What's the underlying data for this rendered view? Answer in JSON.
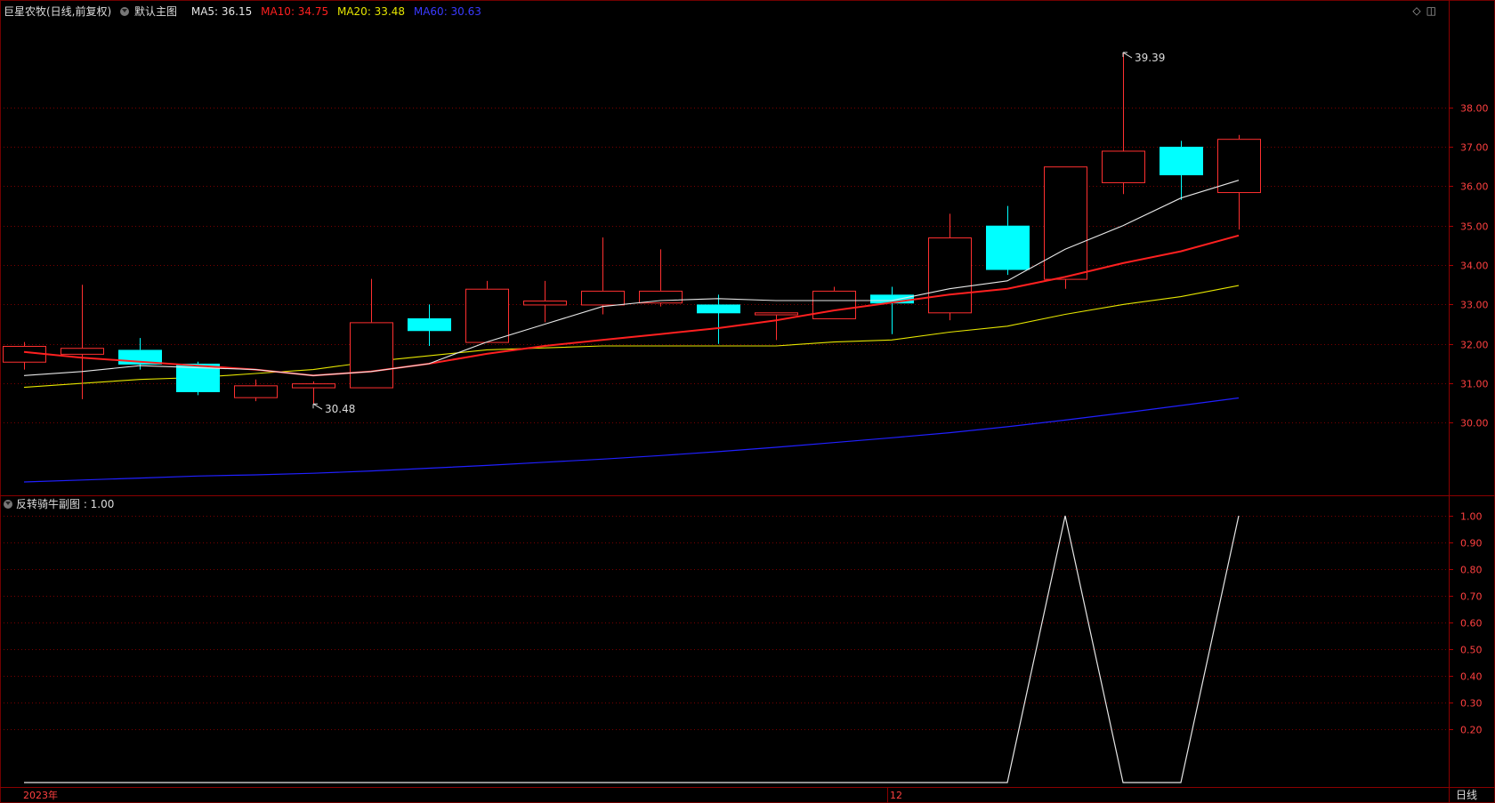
{
  "header": {
    "stock": "巨星农牧(日线,前复权)",
    "template": "默认主图",
    "ma5": "MA5: 36.15",
    "ma10": "MA10: 34.75",
    "ma20": "MA20: 33.48",
    "ma60": "MA60: 30.63"
  },
  "sub_header": "反转骑牛副图 : 1.00",
  "period_label": "日线",
  "icons": [
    "diamond-icon",
    "window-icon"
  ],
  "colors": {
    "ma5": "#e6e6e6",
    "ma10": "#ff2020",
    "ma20": "#e6e600",
    "ma60": "#2020ff",
    "up": "#ff3030",
    "down": "#00ffff",
    "grid": "#7a0000",
    "axis_text": "#ff4040"
  },
  "chart_data": [
    {
      "type": "candlestick",
      "title": "巨星农牧(日线,前复权)",
      "x_labels": [
        "2023年",
        "12"
      ],
      "ylim": [
        28.5,
        40.0
      ],
      "y_ticks": [
        30.0,
        31.0,
        32.0,
        33.0,
        34.0,
        35.0,
        36.0,
        37.0,
        38.0
      ],
      "candles": [
        {
          "open": 31.55,
          "high": 32.05,
          "low": 31.35,
          "close": 31.95
        },
        {
          "open": 31.75,
          "high": 33.5,
          "low": 30.6,
          "close": 31.9
        },
        {
          "open": 31.85,
          "high": 32.15,
          "low": 31.35,
          "close": 31.5
        },
        {
          "open": 31.5,
          "high": 31.55,
          "low": 30.7,
          "close": 30.8
        },
        {
          "open": 30.65,
          "high": 31.1,
          "low": 30.55,
          "close": 30.95
        },
        {
          "open": 30.9,
          "high": 31.05,
          "low": 30.48,
          "close": 31.0
        },
        {
          "open": 30.9,
          "high": 33.65,
          "low": 30.9,
          "close": 32.55
        },
        {
          "open": 32.65,
          "high": 33.0,
          "low": 31.95,
          "close": 32.35
        },
        {
          "open": 32.05,
          "high": 33.6,
          "low": 32.05,
          "close": 33.4
        },
        {
          "open": 33.0,
          "high": 33.6,
          "low": 32.55,
          "close": 33.1
        },
        {
          "open": 33.0,
          "high": 34.7,
          "low": 32.75,
          "close": 33.35
        },
        {
          "open": 33.05,
          "high": 34.4,
          "low": 32.95,
          "close": 33.35
        },
        {
          "open": 33.0,
          "high": 33.25,
          "low": 32.0,
          "close": 32.8
        },
        {
          "open": 32.75,
          "high": 32.8,
          "low": 32.1,
          "close": 32.8
        },
        {
          "open": 32.65,
          "high": 33.45,
          "low": 32.65,
          "close": 33.35
        },
        {
          "open": 33.25,
          "high": 33.45,
          "low": 32.25,
          "close": 33.05
        },
        {
          "open": 32.8,
          "high": 35.3,
          "low": 32.6,
          "close": 34.7
        },
        {
          "open": 35.0,
          "high": 35.5,
          "low": 33.75,
          "close": 33.9
        },
        {
          "open": 33.65,
          "high": 36.5,
          "low": 33.4,
          "close": 36.5
        },
        {
          "open": 36.1,
          "high": 39.39,
          "low": 35.8,
          "close": 36.9
        },
        {
          "open": 37.0,
          "high": 37.15,
          "low": 35.65,
          "close": 36.3
        },
        {
          "open": 35.85,
          "high": 37.3,
          "low": 34.9,
          "close": 37.2
        }
      ],
      "ma5": [
        31.2,
        31.3,
        31.45,
        31.4,
        31.35,
        31.2,
        31.3,
        31.5,
        32.05,
        32.5,
        32.95,
        33.1,
        33.15,
        33.1,
        33.1,
        33.1,
        33.4,
        33.6,
        34.4,
        35.0,
        35.7,
        36.15
      ],
      "ma10": [
        31.8,
        31.65,
        31.55,
        31.45,
        31.35,
        31.2,
        31.3,
        31.5,
        31.75,
        31.95,
        32.1,
        32.25,
        32.4,
        32.6,
        32.85,
        33.05,
        33.25,
        33.4,
        33.7,
        34.05,
        34.35,
        34.75
      ],
      "ma20": [
        30.9,
        31.0,
        31.1,
        31.15,
        31.25,
        31.35,
        31.55,
        31.7,
        31.85,
        31.9,
        31.95,
        31.95,
        31.95,
        31.95,
        32.05,
        32.1,
        32.3,
        32.45,
        32.75,
        33.0,
        33.2,
        33.48
      ],
      "ma60": [
        28.5,
        28.55,
        28.6,
        28.65,
        28.68,
        28.72,
        28.78,
        28.85,
        28.92,
        29.0,
        29.08,
        29.17,
        29.27,
        29.38,
        29.5,
        29.62,
        29.75,
        29.9,
        30.07,
        30.25,
        30.44,
        30.63
      ],
      "annotations": [
        {
          "label": "39.39",
          "candle": 19,
          "value": 39.39
        },
        {
          "label": "30.48",
          "candle": 5,
          "value": 30.48
        }
      ]
    },
    {
      "type": "line",
      "title": "反转骑牛副图",
      "ylim": [
        0.0,
        1.0
      ],
      "y_ticks": [
        0.2,
        0.3,
        0.4,
        0.5,
        0.6,
        0.7,
        0.8,
        0.9,
        1.0
      ],
      "y_tick_labels": [
        "0.20",
        "0.30",
        "0.40",
        "0.50",
        "0.60",
        "0.70",
        "0.80",
        "0.90",
        "1.00"
      ],
      "series": [
        {
          "values": [
            0,
            0,
            0,
            0,
            0,
            0,
            0,
            0,
            0,
            0,
            0,
            0,
            0,
            0,
            0,
            0,
            0,
            0,
            1.0,
            0,
            0,
            1.0
          ]
        }
      ]
    }
  ]
}
